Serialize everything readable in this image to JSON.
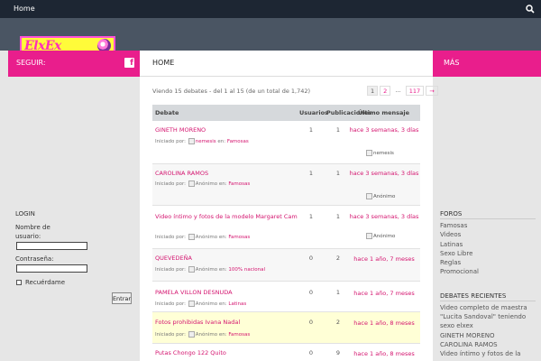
{
  "topbar": {
    "home_label": "Home",
    "search_icon": "search-icon"
  },
  "logo": {
    "text": "ElxEx"
  },
  "left_bar": {
    "label": "SEGUIR:",
    "icon": "facebook-icon"
  },
  "right_bar": {
    "label": "MÁS"
  },
  "main": {
    "tab": "HOME",
    "count_text": "Viendo 15 debates - del 1 al 15 (de un total de 1,742)",
    "pager": [
      "1",
      "2",
      "…",
      "117",
      "→"
    ],
    "headers": {
      "topic": "Debate",
      "voices": "Usuarios",
      "posts": "Publicaciones",
      "freshness": "Último mensaje"
    },
    "started_by": "Iniciado por:",
    "in": "en:",
    "topics": [
      {
        "title": "GINETH MORENO",
        "author": "nemesis",
        "forum": "Famosas",
        "voices": "1",
        "posts": "1",
        "fresh": "hace 3 semanas, 3 días",
        "last_user": "nemesis"
      },
      {
        "title": "CAROLINA RAMOS",
        "author": "Anónimo",
        "forum": "Famosas",
        "voices": "1",
        "posts": "1",
        "fresh": "hace 3 semanas, 3 días",
        "last_user": "Anónimo"
      },
      {
        "title": "Video íntimo y fotos de la modelo Margaret Campuzano Ex combate Video íntimo",
        "author": "Anónimo",
        "forum": "Famosas",
        "voices": "1",
        "posts": "1",
        "fresh": "hace 3 semanas, 3 días",
        "last_user": "Anónimo"
      },
      {
        "title": "QUEVEDEÑA",
        "author": "Anónimo",
        "forum": "100% nacional",
        "voices": "0",
        "posts": "2",
        "fresh": "hace 1 año, 7 meses",
        "last_user": ""
      },
      {
        "title": "PAMELA VILLON DESNUDA",
        "author": "Anónimo",
        "forum": "Latinas",
        "voices": "0",
        "posts": "1",
        "fresh": "hace 1 año, 7 meses",
        "last_user": ""
      },
      {
        "title": "Fotos prohibidas Ivana Nadal",
        "author": "Anónimo",
        "forum": "Famosas",
        "voices": "0",
        "posts": "2",
        "fresh": "hace 1 año, 8 meses",
        "last_user": ""
      },
      {
        "title": "Putas Chongo 122 Quito",
        "author": "",
        "forum": "",
        "voices": "0",
        "posts": "9",
        "fresh": "hace 1 año, 8 meses",
        "last_user": ""
      }
    ]
  },
  "login": {
    "title": "LOGIN",
    "username_label": "Nombre de usuario:",
    "password_label": "Contraseña:",
    "remember_label": "Recuérdame",
    "submit_label": "Entrar"
  },
  "sidebar_right": {
    "forums_title": "FOROS",
    "forums": [
      "Famosas",
      "Videos",
      "Latinas",
      "Sexo Libre",
      "Reglas",
      "Promocional"
    ],
    "recent_title": "DEBATES RECIENTES",
    "recent": [
      "Video completo de maestra",
      "\"Lucita Sandoval\" teniendo",
      "sexo elxex",
      "GINETH MORENO",
      "CAROLINA RAMOS",
      "Video íntimo y fotos de la"
    ]
  },
  "colors": {
    "accent": "#e91e8c",
    "topbar": "#1d2633",
    "header": "#4a5563",
    "link": "#d4146f"
  }
}
